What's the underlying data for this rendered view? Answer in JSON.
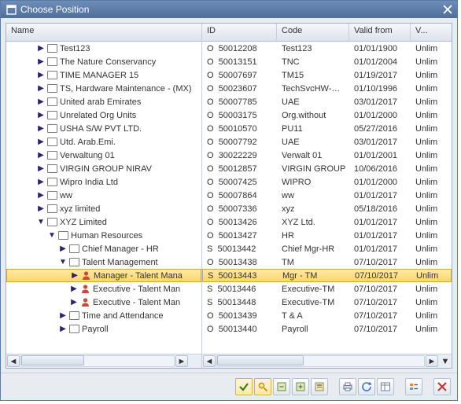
{
  "window": {
    "title": "Choose Position"
  },
  "columns": {
    "name": "Name",
    "id": "ID",
    "code": "Code",
    "valid_from": "Valid from",
    "valid_to": "V..."
  },
  "rows": [
    {
      "depth": 2,
      "exp": "closed",
      "icon": "org",
      "name": "Test123",
      "t": "O",
      "id": "50012208",
      "code": "Test123",
      "vf": "01/01/1900",
      "vt": "Unlim"
    },
    {
      "depth": 2,
      "exp": "closed",
      "icon": "org",
      "name": "The Nature Conservancy",
      "t": "O",
      "id": "50013151",
      "code": "TNC",
      "vf": "01/01/2004",
      "vt": "Unlim"
    },
    {
      "depth": 2,
      "exp": "closed",
      "icon": "org",
      "name": "TIME MANAGER 15",
      "t": "O",
      "id": "50007697",
      "code": "TM15",
      "vf": "01/19/2017",
      "vt": "Unlim"
    },
    {
      "depth": 2,
      "exp": "closed",
      "icon": "org",
      "name": "TS, Hardware Maintenance - (MX)",
      "t": "O",
      "id": "50023607",
      "code": "TechSvcHW-…",
      "vf": "01/10/1996",
      "vt": "Unlim"
    },
    {
      "depth": 2,
      "exp": "closed",
      "icon": "org",
      "name": "United arab Emirates",
      "t": "O",
      "id": "50007785",
      "code": "UAE",
      "vf": "03/01/2017",
      "vt": "Unlim"
    },
    {
      "depth": 2,
      "exp": "closed",
      "icon": "org",
      "name": "Unrelated Org Units",
      "t": "O",
      "id": "50003175",
      "code": "Org.without",
      "vf": "01/01/2000",
      "vt": "Unlim"
    },
    {
      "depth": 2,
      "exp": "closed",
      "icon": "org",
      "name": "USHA S/W PVT LTD.",
      "t": "O",
      "id": "50010570",
      "code": "PU11",
      "vf": "05/27/2016",
      "vt": "Unlim"
    },
    {
      "depth": 2,
      "exp": "closed",
      "icon": "org",
      "name": "Utd. Arab.Emi.",
      "t": "O",
      "id": "50007792",
      "code": "UAE",
      "vf": "03/01/2017",
      "vt": "Unlim"
    },
    {
      "depth": 2,
      "exp": "closed",
      "icon": "org",
      "name": "Verwaltung 01",
      "t": "O",
      "id": "30022229",
      "code": "Verwalt 01",
      "vf": "01/01/2001",
      "vt": "Unlim"
    },
    {
      "depth": 2,
      "exp": "closed",
      "icon": "org",
      "name": "VIRGIN GROUP NIRAV",
      "t": "O",
      "id": "50012857",
      "code": "VIRGIN GROUP",
      "vf": "10/06/2016",
      "vt": "Unlim"
    },
    {
      "depth": 2,
      "exp": "closed",
      "icon": "org",
      "name": "Wipro India Ltd",
      "t": "O",
      "id": "50007425",
      "code": "WIPRO",
      "vf": "01/01/2000",
      "vt": "Unlim"
    },
    {
      "depth": 2,
      "exp": "closed",
      "icon": "org",
      "name": "ww",
      "t": "O",
      "id": "50007864",
      "code": "ww",
      "vf": "01/01/2017",
      "vt": "Unlim"
    },
    {
      "depth": 2,
      "exp": "closed",
      "icon": "org",
      "name": "xyz limited",
      "t": "O",
      "id": "50007336",
      "code": "xyz",
      "vf": "05/18/2016",
      "vt": "Unlim"
    },
    {
      "depth": 2,
      "exp": "open",
      "icon": "org",
      "name": "XYZ Limited",
      "t": "O",
      "id": "50013426",
      "code": "XYZ Ltd.",
      "vf": "01/01/2017",
      "vt": "Unlim"
    },
    {
      "depth": 3,
      "exp": "open",
      "icon": "org",
      "name": "Human Resources",
      "t": "O",
      "id": "50013427",
      "code": "HR",
      "vf": "01/01/2017",
      "vt": "Unlim"
    },
    {
      "depth": 4,
      "exp": "closed",
      "icon": "pos",
      "name": "Chief Manager - HR",
      "t": "S",
      "id": "50013442",
      "code": "Chief Mgr-HR",
      "vf": "01/01/2017",
      "vt": "Unlim"
    },
    {
      "depth": 4,
      "exp": "open",
      "icon": "org",
      "name": "Talent Management",
      "t": "O",
      "id": "50013438",
      "code": "TM",
      "vf": "07/10/2017",
      "vt": "Unlim"
    },
    {
      "depth": 5,
      "exp": "closed",
      "icon": "person",
      "name": "Manager - Talent Mana",
      "t": "S",
      "id": "50013443",
      "code": "Mgr - TM",
      "vf": "07/10/2017",
      "vt": "Unlim",
      "selected": true
    },
    {
      "depth": 5,
      "exp": "closed",
      "icon": "person",
      "name": "Executive - Talent Man",
      "t": "S",
      "id": "50013446",
      "code": "Executive-TM",
      "vf": "07/10/2017",
      "vt": "Unlim"
    },
    {
      "depth": 5,
      "exp": "closed",
      "icon": "person",
      "name": "Executive - Talent Man",
      "t": "S",
      "id": "50013448",
      "code": "Executive-TM",
      "vf": "07/10/2017",
      "vt": "Unlim"
    },
    {
      "depth": 4,
      "exp": "closed",
      "icon": "org",
      "name": "Time and Attendance",
      "t": "O",
      "id": "50013439",
      "code": "T & A",
      "vf": "07/10/2017",
      "vt": "Unlim"
    },
    {
      "depth": 4,
      "exp": "closed",
      "icon": "org",
      "name": "Payroll",
      "t": "O",
      "id": "50013440",
      "code": "Payroll",
      "vf": "07/10/2017",
      "vt": "Unlim"
    }
  ],
  "toolbar": {
    "ok": "OK",
    "find": "Find",
    "collapse": "Collapse",
    "expand": "Expand",
    "variant": "Variant",
    "print": "Print",
    "refresh": "Refresh",
    "layout": "Layout",
    "legend": "Legend",
    "cancel": "Cancel"
  }
}
